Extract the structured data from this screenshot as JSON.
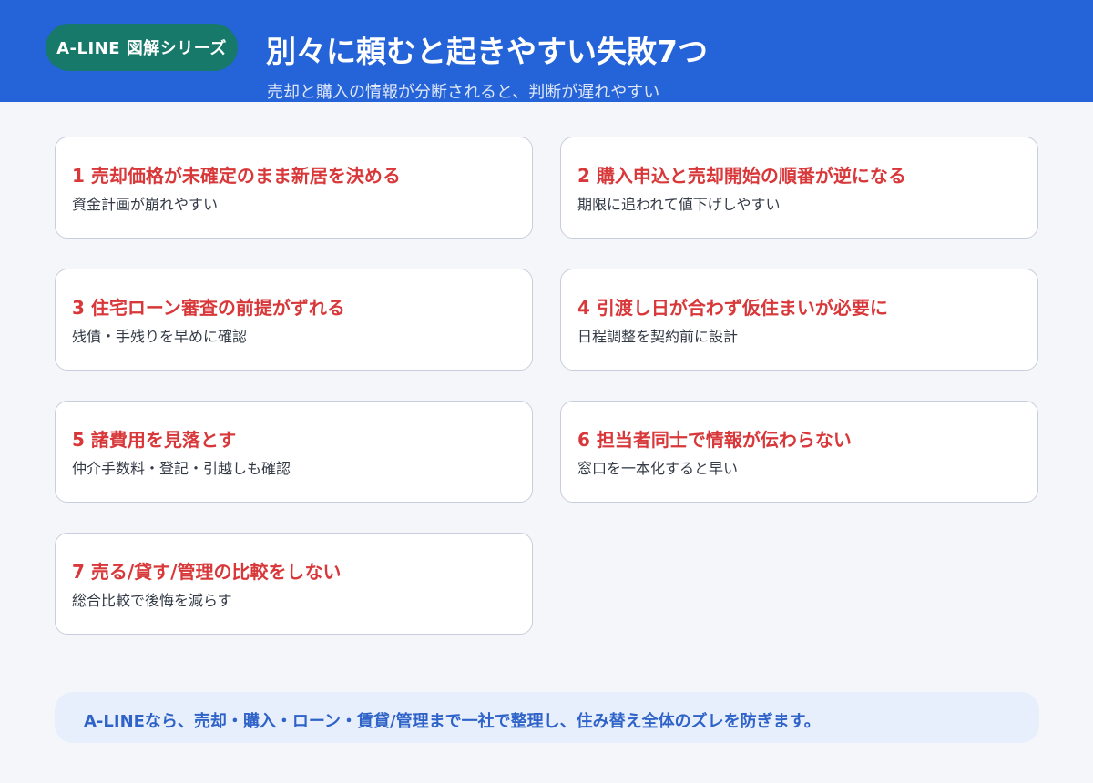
{
  "header": {
    "badge": "A-LINE 図解シリーズ",
    "title": "別々に頼むと起きやすい失敗7つ",
    "subtitle": "売却と購入の情報が分断されると、判断が遅れやすい"
  },
  "cards": [
    {
      "title": "1 売却価格が未確定のまま新居を決める",
      "desc": "資金計画が崩れやすい"
    },
    {
      "title": "2 購入申込と売却開始の順番が逆になる",
      "desc": "期限に追われて値下げしやすい"
    },
    {
      "title": "3 住宅ローン審査の前提がずれる",
      "desc": "残債・手残りを早めに確認"
    },
    {
      "title": "4 引渡し日が合わず仮住まいが必要に",
      "desc": "日程調整を契約前に設計"
    },
    {
      "title": "5 諸費用を見落とす",
      "desc": "仲介手数料・登記・引越しも確認"
    },
    {
      "title": "6 担当者同士で情報が伝わらない",
      "desc": "窓口を一本化すると早い"
    },
    {
      "title": "7 売る/貸す/管理の比較をしない",
      "desc": "総合比較で後悔を減らす"
    }
  ],
  "footer": {
    "text": "A-LINEなら、売却・購入・ローン・賃貸/管理まで一社で整理し、住み替え全体のズレを防ぎます。"
  },
  "colors": {
    "header_bg": "#2563d9",
    "badge_bg": "#16796a",
    "card_title": "#d8383a",
    "footer_text": "#2f63c8"
  }
}
